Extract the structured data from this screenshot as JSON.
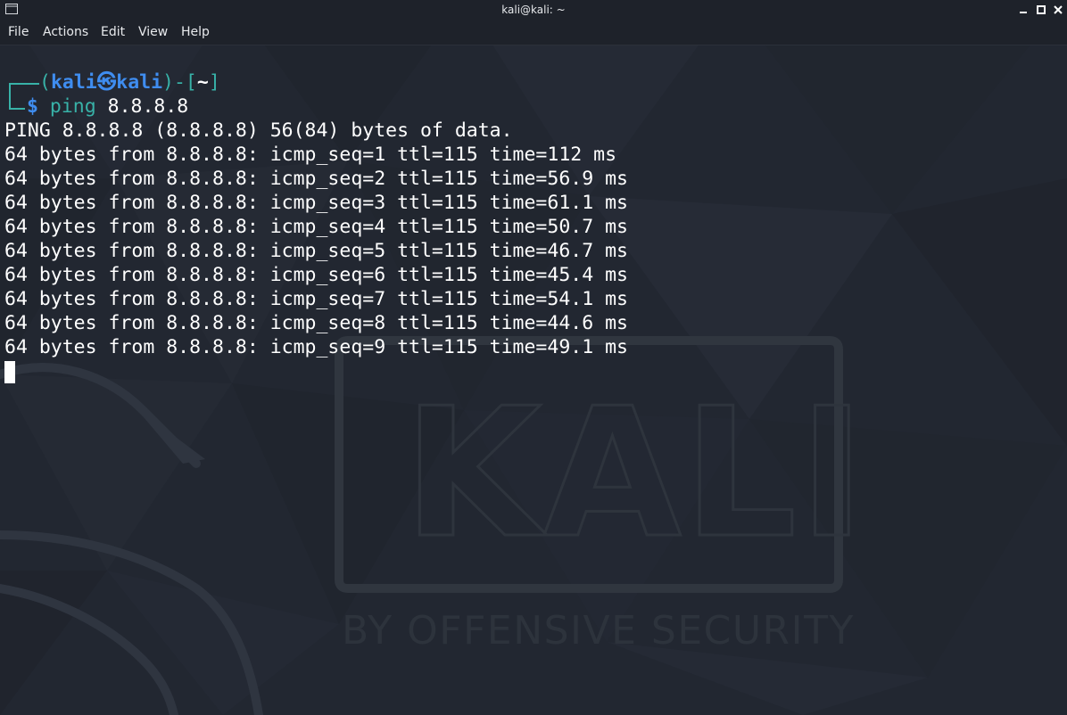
{
  "window": {
    "title": "kali@kali: ~",
    "icons": {
      "app": "terminal-icon",
      "minimize": "minimize-icon",
      "maximize": "maximize-icon",
      "close": "close-icon"
    }
  },
  "menu": {
    "items": [
      "File",
      "Actions",
      "Edit",
      "View",
      "Help"
    ]
  },
  "prompt": {
    "open": "(",
    "user": "kali",
    "at_symbol": "㉿",
    "host": "kali",
    "close": ")-[",
    "path": "~",
    "end": "]",
    "dollar": "$",
    "command": "ping",
    "argument": "8.8.8.8"
  },
  "output": {
    "header": "PING 8.8.8.8 (8.8.8.8) 56(84) bytes of data.",
    "lines": [
      "64 bytes from 8.8.8.8: icmp_seq=1 ttl=115 time=112 ms",
      "64 bytes from 8.8.8.8: icmp_seq=2 ttl=115 time=56.9 ms",
      "64 bytes from 8.8.8.8: icmp_seq=3 ttl=115 time=61.1 ms",
      "64 bytes from 8.8.8.8: icmp_seq=4 ttl=115 time=50.7 ms",
      "64 bytes from 8.8.8.8: icmp_seq=5 ttl=115 time=46.7 ms",
      "64 bytes from 8.8.8.8: icmp_seq=6 ttl=115 time=45.4 ms",
      "64 bytes from 8.8.8.8: icmp_seq=7 ttl=115 time=54.1 ms",
      "64 bytes from 8.8.8.8: icmp_seq=8 ttl=115 time=44.6 ms",
      "64 bytes from 8.8.8.8: icmp_seq=9 ttl=115 time=49.1 ms"
    ]
  },
  "wallpaper": {
    "logo_text": "KALI",
    "tagline": "BY OFFENSIVE SECURITY"
  },
  "colors": {
    "background": "#222731",
    "prompt_blue": "#3f8df0",
    "prompt_teal": "#38b2a8",
    "text": "#ffffff"
  }
}
